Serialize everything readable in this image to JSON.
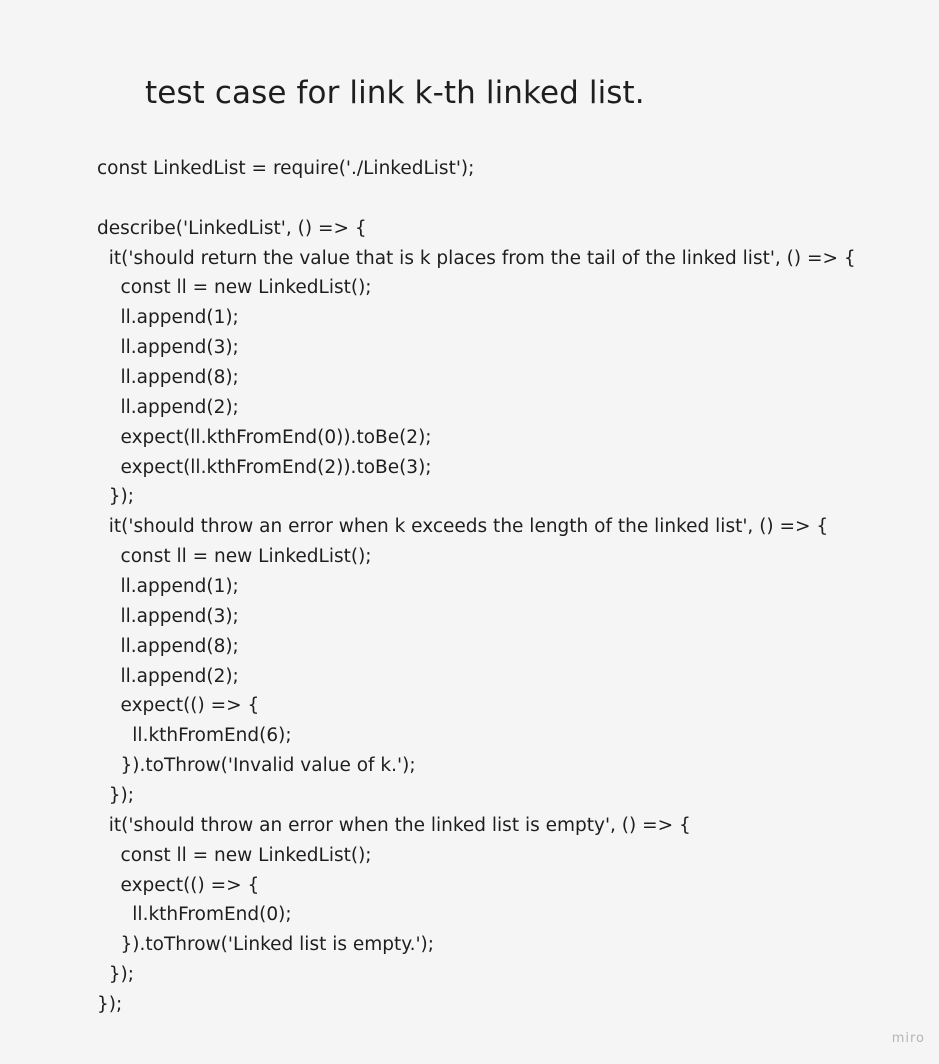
{
  "title": "test case for link k-th linked list.",
  "code_lines": [
    "const LinkedList = require('./LinkedList');",
    "",
    "describe('LinkedList', () => {",
    "  it('should return the value that is k places from the tail of the linked list', () => {",
    "    const ll = new LinkedList();",
    "    ll.append(1);",
    "    ll.append(3);",
    "    ll.append(8);",
    "    ll.append(2);",
    "    expect(ll.kthFromEnd(0)).toBe(2);",
    "    expect(ll.kthFromEnd(2)).toBe(3);",
    "  });",
    "  it('should throw an error when k exceeds the length of the linked list', () => {",
    "    const ll = new LinkedList();",
    "    ll.append(1);",
    "    ll.append(3);",
    "    ll.append(8);",
    "    ll.append(2);",
    "    expect(() => {",
    "      ll.kthFromEnd(6);",
    "    }).toThrow('Invalid value of k.');",
    "  });",
    "  it('should throw an error when the linked list is empty', () => {",
    "    const ll = new LinkedList();",
    "    expect(() => {",
    "      ll.kthFromEnd(0);",
    "    }).toThrow('Linked list is empty.');",
    "  });",
    "});"
  ],
  "watermark": "miro"
}
